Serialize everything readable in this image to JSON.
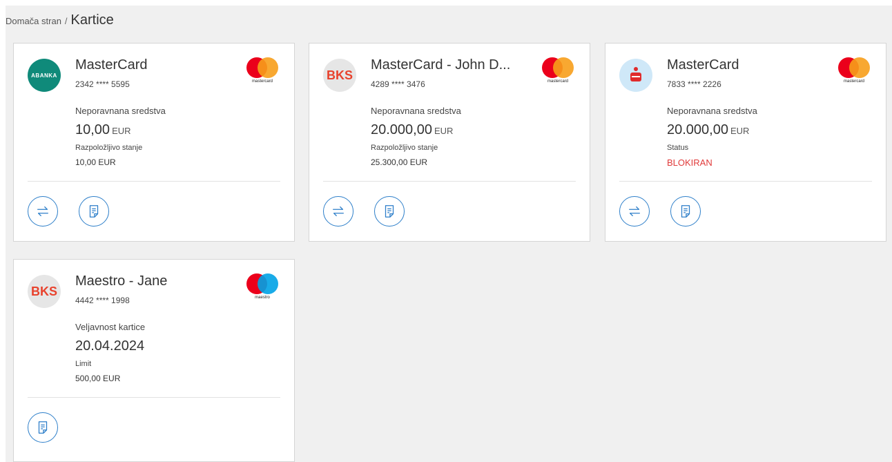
{
  "breadcrumb": {
    "home": "Domača stran",
    "separator": "/",
    "current": "Kartice"
  },
  "icons": {
    "transfer": "transfer-arrows-icon",
    "statement": "document-icon"
  },
  "colors": {
    "accent": "#2c7ec9",
    "blocked": "#e03a3a",
    "abanka": "#0f8a7a",
    "bks": "#e8422d"
  },
  "cards": [
    {
      "bank_logo_text": "ABANKA",
      "title": "MasterCard",
      "number": "2342 **** 5595",
      "brand_label": "mastercard",
      "label1": "Neporavnana sredstva",
      "amount": "10,00",
      "currency": "EUR",
      "label2": "Razpoložljivo stanje",
      "value2": "10,00 EUR"
    },
    {
      "bank_logo_text": "BKS",
      "title": "MasterCard - John D...",
      "number": "4289 **** 3476",
      "brand_label": "mastercard",
      "label1": "Neporavnana sredstva",
      "amount": "20.000,00",
      "currency": "EUR",
      "label2": "Razpoložljivo stanje",
      "value2": "25.300,00 EUR"
    },
    {
      "bank_logo_text": "",
      "title": "MasterCard",
      "number": "7833 **** 2226",
      "brand_label": "mastercard",
      "label1": "Neporavnana sredstva",
      "amount": "20.000,00",
      "currency": "EUR",
      "label2": "Status",
      "value2": "BLOKIRAN"
    },
    {
      "bank_logo_text": "BKS",
      "title": "Maestro - Jane",
      "number": "4442 **** 1998",
      "brand_label": "maestro",
      "label1": "Veljavnost kartice",
      "amount": "20.04.2024",
      "label2": "Limit",
      "value2": "500,00 EUR"
    }
  ]
}
